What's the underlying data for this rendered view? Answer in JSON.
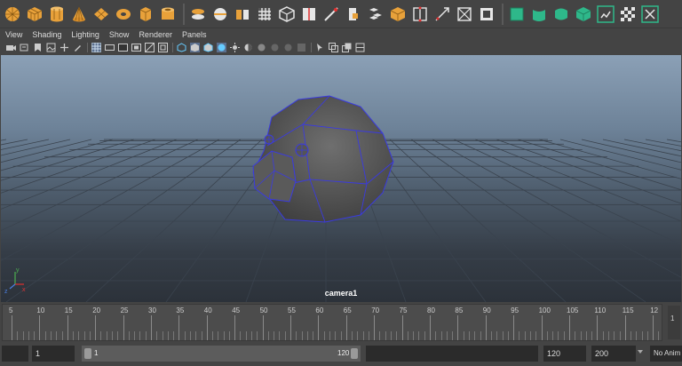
{
  "menubar": {
    "items": [
      "View",
      "Shading",
      "Lighting",
      "Show",
      "Renderer",
      "Panels"
    ]
  },
  "viewport": {
    "camera_label": "camera1",
    "axis": {
      "x": "x",
      "y": "y",
      "z": "z"
    }
  },
  "timeline": {
    "ticks": [
      "5",
      "10",
      "15",
      "20",
      "25",
      "30",
      "35",
      "40",
      "45",
      "50",
      "55",
      "60",
      "65",
      "70",
      "75",
      "80",
      "85",
      "90",
      "95",
      "100",
      "105",
      "110",
      "115",
      "12"
    ],
    "side_label": "1"
  },
  "range": {
    "start_field": "1",
    "slider_start": "1",
    "slider_end": "120",
    "end_field": "120",
    "max_field": "200",
    "anim_layer": "No Anim"
  },
  "colors": {
    "shelf_orange": "#e8a13a",
    "shelf_white": "#e6e6e6",
    "shelf_teal": "#2eb88a",
    "selection_wire": "#3a3ae0"
  }
}
